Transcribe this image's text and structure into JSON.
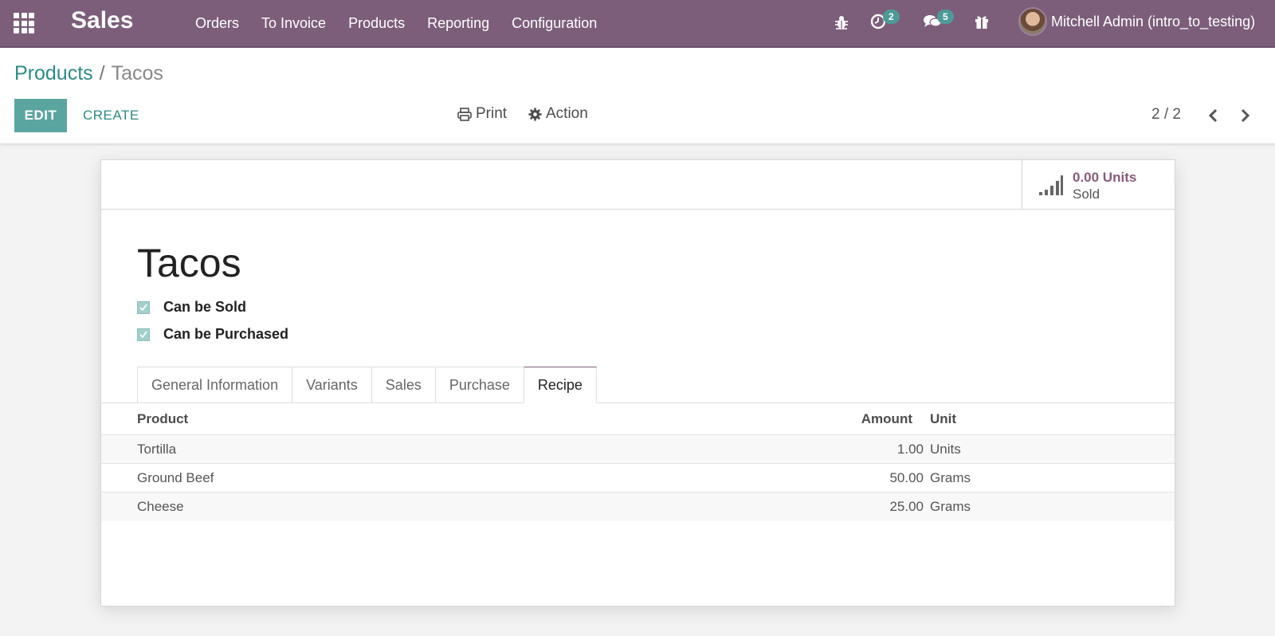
{
  "navbar": {
    "app_name": "Sales",
    "menu": [
      "Orders",
      "To Invoice",
      "Products",
      "Reporting",
      "Configuration"
    ],
    "activity_count": "2",
    "messages_count": "5",
    "user_name": "Mitchell Admin (intro_to_testing)"
  },
  "breadcrumb": {
    "parent": "Products",
    "separator": "/",
    "current": "Tacos"
  },
  "controls": {
    "edit_label": "EDIT",
    "create_label": "CREATE",
    "print_label": "Print",
    "action_label": "Action",
    "pager": "2 / 2"
  },
  "stat_button": {
    "value": "0.00 Units",
    "label": "Sold"
  },
  "product": {
    "name": "Tacos",
    "can_be_sold": "Can be Sold",
    "can_be_purchased": "Can be Purchased"
  },
  "tabs": [
    "General Information",
    "Variants",
    "Sales",
    "Purchase",
    "Recipe"
  ],
  "active_tab": "Recipe",
  "recipe": {
    "headers": {
      "product": "Product",
      "amount": "Amount",
      "unit": "Unit"
    },
    "rows": [
      {
        "product": "Tortilla",
        "amount": "1.00",
        "unit": "Units"
      },
      {
        "product": "Ground Beef",
        "amount": "50.00",
        "unit": "Grams"
      },
      {
        "product": "Cheese",
        "amount": "25.00",
        "unit": "Grams"
      }
    ]
  },
  "colors": {
    "navbar": "#7c5e7a",
    "accent": "#5aa5a0",
    "link": "#2d8a85",
    "stat_value": "#875a7b"
  },
  "icons": [
    "apps-grid-icon",
    "bug-icon",
    "activity-clock-icon",
    "chat-icon",
    "gift-icon",
    "printer-icon",
    "gear-icon",
    "chevron-left-icon",
    "chevron-right-icon",
    "bar-chart-icon",
    "checkmark-icon"
  ]
}
